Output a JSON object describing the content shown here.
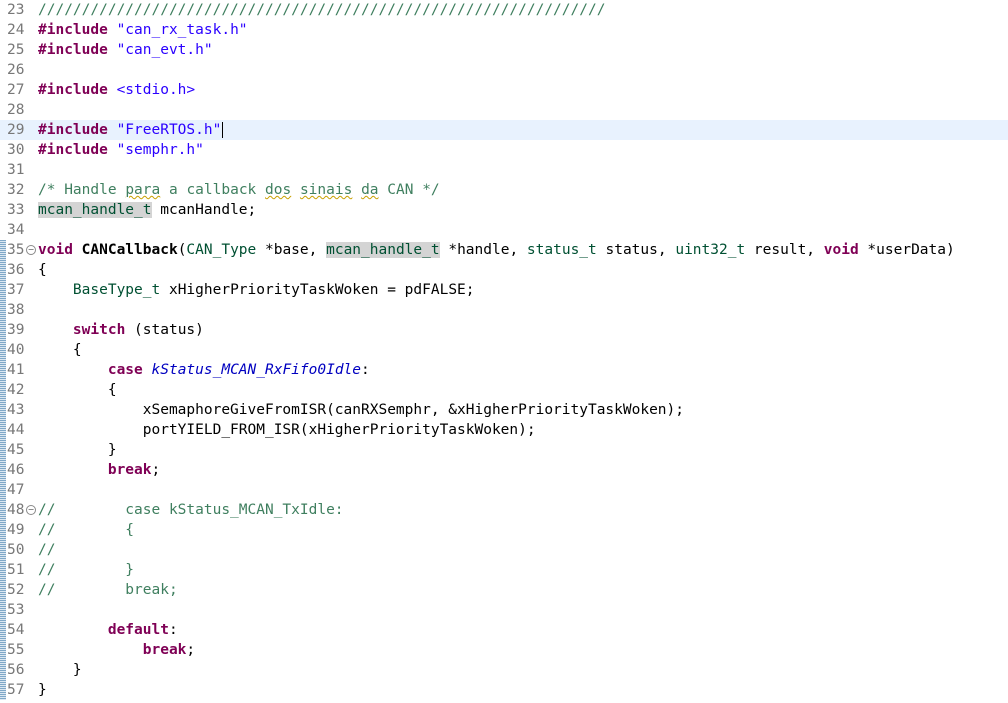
{
  "editor": {
    "lines": [
      {
        "n": "23",
        "stripe": false
      },
      {
        "n": "24",
        "stripe": false
      },
      {
        "n": "25",
        "stripe": false
      },
      {
        "n": "26",
        "stripe": false
      },
      {
        "n": "27",
        "stripe": false
      },
      {
        "n": "28",
        "stripe": false
      },
      {
        "n": "29",
        "stripe": false
      },
      {
        "n": "30",
        "stripe": false
      },
      {
        "n": "31",
        "stripe": false
      },
      {
        "n": "32",
        "stripe": false
      },
      {
        "n": "33",
        "stripe": false
      },
      {
        "n": "34",
        "stripe": false
      },
      {
        "n": "35",
        "stripe": true,
        "fold": true
      },
      {
        "n": "36",
        "stripe": true
      },
      {
        "n": "37",
        "stripe": true
      },
      {
        "n": "38",
        "stripe": true
      },
      {
        "n": "39",
        "stripe": true
      },
      {
        "n": "40",
        "stripe": true
      },
      {
        "n": "41",
        "stripe": true
      },
      {
        "n": "42",
        "stripe": true
      },
      {
        "n": "43",
        "stripe": true
      },
      {
        "n": "44",
        "stripe": true
      },
      {
        "n": "45",
        "stripe": true
      },
      {
        "n": "46",
        "stripe": true
      },
      {
        "n": "47",
        "stripe": true
      },
      {
        "n": "48",
        "stripe": true,
        "fold": true
      },
      {
        "n": "49",
        "stripe": true
      },
      {
        "n": "50",
        "stripe": true
      },
      {
        "n": "51",
        "stripe": true
      },
      {
        "n": "52",
        "stripe": true
      },
      {
        "n": "53",
        "stripe": true
      },
      {
        "n": "54",
        "stripe": true
      },
      {
        "n": "55",
        "stripe": true
      },
      {
        "n": "56",
        "stripe": true
      },
      {
        "n": "57",
        "stripe": true
      }
    ],
    "fold_glyph": "−",
    "code": {
      "l23": "/////////////////////////////////////////////////////////////////",
      "inc": "#include",
      "l24_str": "\"can_rx_task.h\"",
      "l25_str": "\"can_evt.h\"",
      "l27_str": "<stdio.h>",
      "l29_str": "\"FreeRTOS.h\"",
      "l30_str": "\"semphr.h\"",
      "l32_a": "/* ",
      "l32_w1": "Handle",
      "l32_s1": " ",
      "l32_w2": "para",
      "l32_s2": " a callback ",
      "l32_w3": "dos",
      "l32_s3": " ",
      "l32_w4": "sinais",
      "l32_s4": " ",
      "l32_w5": "da",
      "l32_b": " CAN */",
      "l33_type": "mcan_handle_t",
      "l33_rest": " mcanHandle;",
      "l35_void": "void",
      "l35_fn": " CANCallback",
      "l35_p1": "(",
      "l35_t1": "CAN_Type",
      "l35_p2": " *base, ",
      "l35_t2": "mcan_handle_t",
      "l35_p3": " *handle, ",
      "l35_t3": "status_t",
      "l35_p4": " status, ",
      "l35_t4": "uint32_t",
      "l35_p5": " result, ",
      "l35_void2": "void",
      "l35_p6": " *userData)",
      "l36": "{",
      "l37_ind": "    ",
      "l37_type": "BaseType_t",
      "l37_rest": " xHigherPriorityTaskWoken = pdFALSE;",
      "l39_ind": "    ",
      "l39_kw": "switch",
      "l39_rest": " (status)",
      "l40": "    {",
      "l41_ind": "        ",
      "l41_kw": "case",
      "l41_sp": " ",
      "l41_en": "kStatus_MCAN_RxFifo0Idle",
      "l41_colon": ":",
      "l42": "        {",
      "l43": "            xSemaphoreGiveFromISR(canRXSemphr, &xHigherPriorityTaskWoken);",
      "l44": "            portYIELD_FROM_ISR(xHigherPriorityTaskWoken);",
      "l45": "        }",
      "l46_ind": "        ",
      "l46_kw": "break",
      "l46_rest": ";",
      "l48": "//        case kStatus_MCAN_TxIdle:",
      "l49": "//        {",
      "l50": "//",
      "l51": "//        }",
      "l52": "//        break;",
      "l54_ind": "        ",
      "l54_kw": "default",
      "l54_rest": ":",
      "l55_ind": "            ",
      "l55_kw": "break",
      "l55_rest": ";",
      "l56": "    }",
      "l57": "}"
    }
  }
}
